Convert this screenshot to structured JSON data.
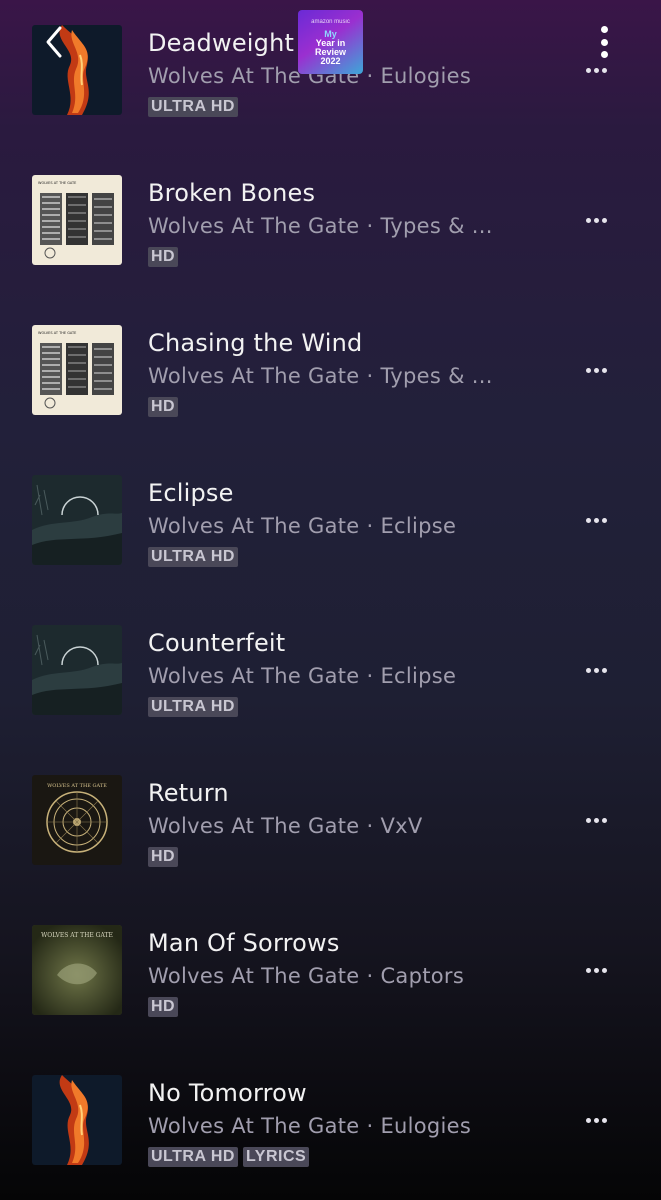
{
  "header": {
    "back_icon": "chevron-left-icon",
    "year_in_review": {
      "brand": "amazon music",
      "line1": "My",
      "line2": "Year in",
      "line3": "Review",
      "line4": "2022"
    },
    "menu_icon": "vertical-dots-icon"
  },
  "tracks": [
    {
      "title": "Deadweight",
      "subtitle": "Wolves At The Gate · Eulogies",
      "badges": [
        "ULTRA HD"
      ],
      "cover": "eulogies"
    },
    {
      "title": "Broken Bones",
      "subtitle": "Wolves At The Gate · Types & ...",
      "badges": [
        "HD"
      ],
      "cover": "types"
    },
    {
      "title": "Chasing the Wind",
      "subtitle": "Wolves At The Gate · Types & ...",
      "badges": [
        "HD"
      ],
      "cover": "types"
    },
    {
      "title": "Eclipse",
      "subtitle": "Wolves At The Gate · Eclipse",
      "badges": [
        "ULTRA HD"
      ],
      "cover": "eclipse"
    },
    {
      "title": "Counterfeit",
      "subtitle": "Wolves At The Gate · Eclipse",
      "badges": [
        "ULTRA HD"
      ],
      "cover": "eclipse"
    },
    {
      "title": "Return",
      "subtitle": "Wolves At The Gate · VxV",
      "badges": [
        "HD"
      ],
      "cover": "vxv"
    },
    {
      "title": "Man Of Sorrows",
      "subtitle": "Wolves At The Gate · Captors",
      "badges": [
        "HD"
      ],
      "cover": "captors"
    },
    {
      "title": "No Tomorrow",
      "subtitle": "Wolves At The Gate · Eulogies",
      "badges": [
        "ULTRA HD",
        "LYRICS"
      ],
      "cover": "eulogies"
    }
  ],
  "cover_texts": {
    "types_band": "WOLVES AT THE GATE",
    "captors_band": "WOLVES AT THE GATE",
    "vxv_band": "WOLVES AT THE GATE"
  }
}
